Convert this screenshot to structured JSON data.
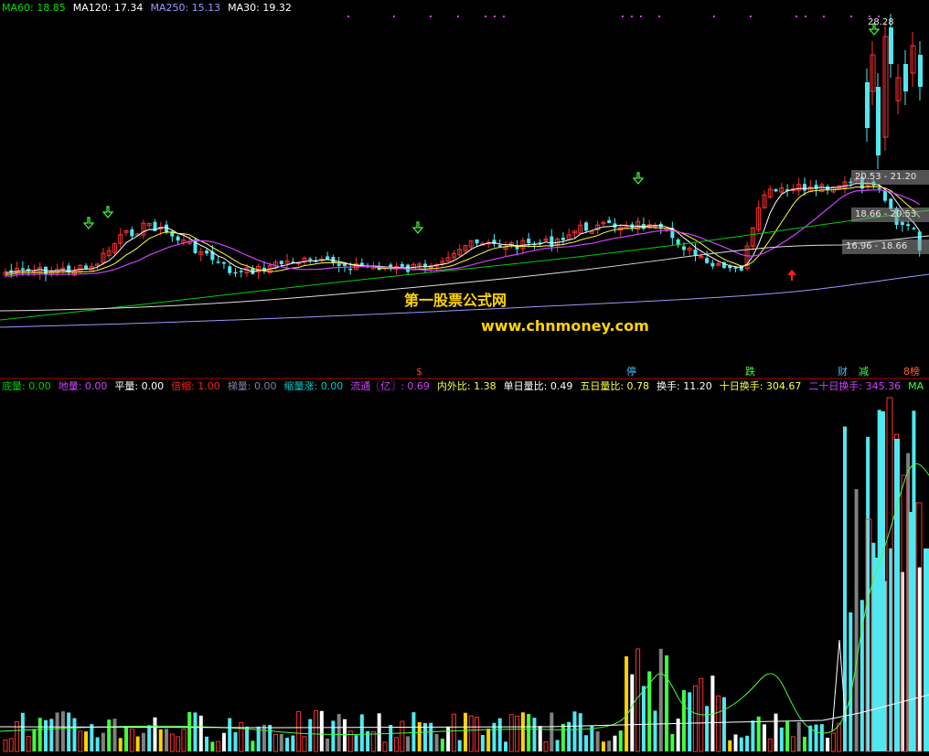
{
  "ma_legend": [
    {
      "label": "MA60: 18.85",
      "color": "#00e000"
    },
    {
      "label": "MA120: 17.34",
      "color": "#ffffff"
    },
    {
      "label": "MA250: 15.13",
      "color": "#9a9aff"
    },
    {
      "label": "MA30: 19.32",
      "color": "#ffffff"
    }
  ],
  "vol_legend": [
    {
      "label": "底量: 0.00",
      "color": "#00d000"
    },
    {
      "label": "地量: 0.00",
      "color": "#d040ff"
    },
    {
      "label": "平量: 0.00",
      "color": "#ffffff"
    },
    {
      "label": "倍缩: 1.00",
      "color": "#ff2020"
    },
    {
      "label": "梯量: 0.00",
      "color": "#8080a0"
    },
    {
      "label": "缩量涨: 0.00",
      "color": "#00c8c8"
    },
    {
      "label": "流通〖亿〗: 0.69",
      "color": "#d040ff"
    },
    {
      "label": "内外比: 1.38",
      "color": "#ffff40"
    },
    {
      "label": "单日量比: 0.49",
      "color": "#ffffff"
    },
    {
      "label": "五日量比: 0.78",
      "color": "#ffff40"
    },
    {
      "label": "换手: 11.20",
      "color": "#ffffff"
    },
    {
      "label": "十日换手: 304.67",
      "color": "#ffff40"
    },
    {
      "label": "二十日换手: 345.36",
      "color": "#d040ff"
    },
    {
      "label": "MA",
      "color": "#40ff40"
    }
  ],
  "tags": [
    {
      "label": "$",
      "color": "#ff3030"
    },
    {
      "label": "停",
      "color": "#40c0ff"
    },
    {
      "label": "跌",
      "color": "#40ff40"
    },
    {
      "label": "财",
      "color": "#40c0ff"
    },
    {
      "label": "减",
      "color": "#40ff40"
    },
    {
      "label": "8榜",
      "color": "#ff6040"
    }
  ],
  "watermark": {
    "line1": "第一股票公式网",
    "line2": "www.chnmoney.com"
  },
  "price_boxes": [
    {
      "label": "20.53 - 21.20"
    },
    {
      "label": "18.66 - 20.53"
    },
    {
      "label": "16.96 - 18.66"
    }
  ],
  "price_high": "28.28",
  "colors": {
    "up": "#ff3030",
    "down": "#50e8f0",
    "ma5": "#ffffff",
    "ma10": "#ffff40",
    "ma20": "#d040ff",
    "ma60": "#00d000",
    "ma120": "#e0e0e0",
    "ma250": "#9a9aff",
    "arrow_green": "#40ff40",
    "arrow_red": "#ff2020",
    "signal_dot": "#d040ff"
  }
}
